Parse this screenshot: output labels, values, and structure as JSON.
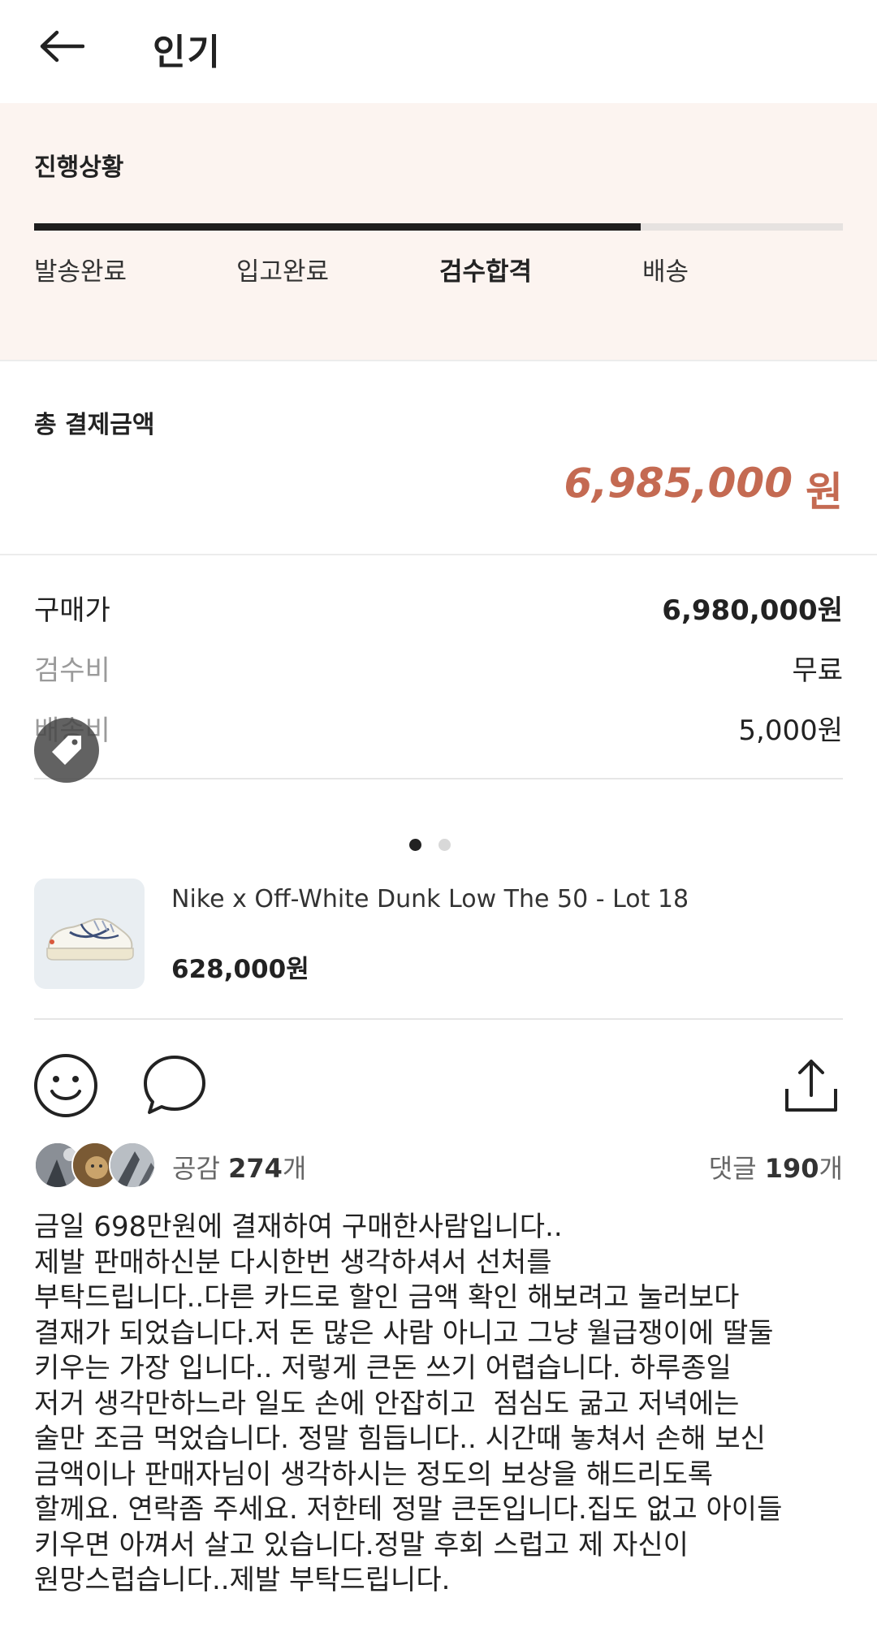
{
  "header": {
    "title": "인기",
    "back_icon": "arrow-left-icon"
  },
  "progress": {
    "title": "진행상황",
    "fill_fraction": 0.75,
    "steps": [
      "발송완료",
      "입고완료",
      "검수합격",
      "배송"
    ],
    "active_step": 2
  },
  "total": {
    "label": "총 결제금액",
    "amount": "6,985,000",
    "unit": "원",
    "color": "#c46a52"
  },
  "details": {
    "purchase_label": "구매가",
    "purchase_value": "6,980,000원",
    "inspection_label": "검수비",
    "inspection_value": "무료",
    "shipping_label": "배송비",
    "shipping_value": "5,000원"
  },
  "carousel": {
    "current": 1,
    "total": 2
  },
  "product": {
    "name": "Nike x Off-White Dunk Low The 50 - Lot 18",
    "price": "628,000원"
  },
  "actions": {
    "like_icon": "smiley-icon",
    "comment_icon": "speech-bubble-icon",
    "share_icon": "share-icon"
  },
  "meta": {
    "likes_label": "공감",
    "likes_count": "274",
    "likes_suffix": "개",
    "comments_label": "댓글",
    "comments_count": "190",
    "comments_suffix": "개"
  },
  "post": {
    "body": "금일 698만원에 결재하여 구매한사람입니다..\n제발 판매하신분 다시한번 생각하셔서 선처를\n부탁드립니다..다른 카드로 할인 금액 확인 해보려고 눌러보다\n결재가 되었습니다.저 돈 많은 사람 아니고 그냥 월급쟁이에 딸둘\n키우는 가장 입니다.. 저렇게 큰돈 쓰기 어렵습니다. 하루종일\n저거 생각만하느라 일도 손에 안잡히고  점심도 굶고 저녁에는\n술만 조금 먹었습니다. 정말 힘듭니다.. 시간때 놓쳐서 손해 보신\n금액이나 판매자님이 생각하시는 정도의 보상을 해드리도록\n할께요. 연락좀 주세요. 저한테 정말 큰돈입니다.집도 없고 아이들\n키우면 아껴서 살고 있습니다.정말 후회 스럽고 제 자신이\n원망스럽습니다..제발 부탁드립니다."
  }
}
